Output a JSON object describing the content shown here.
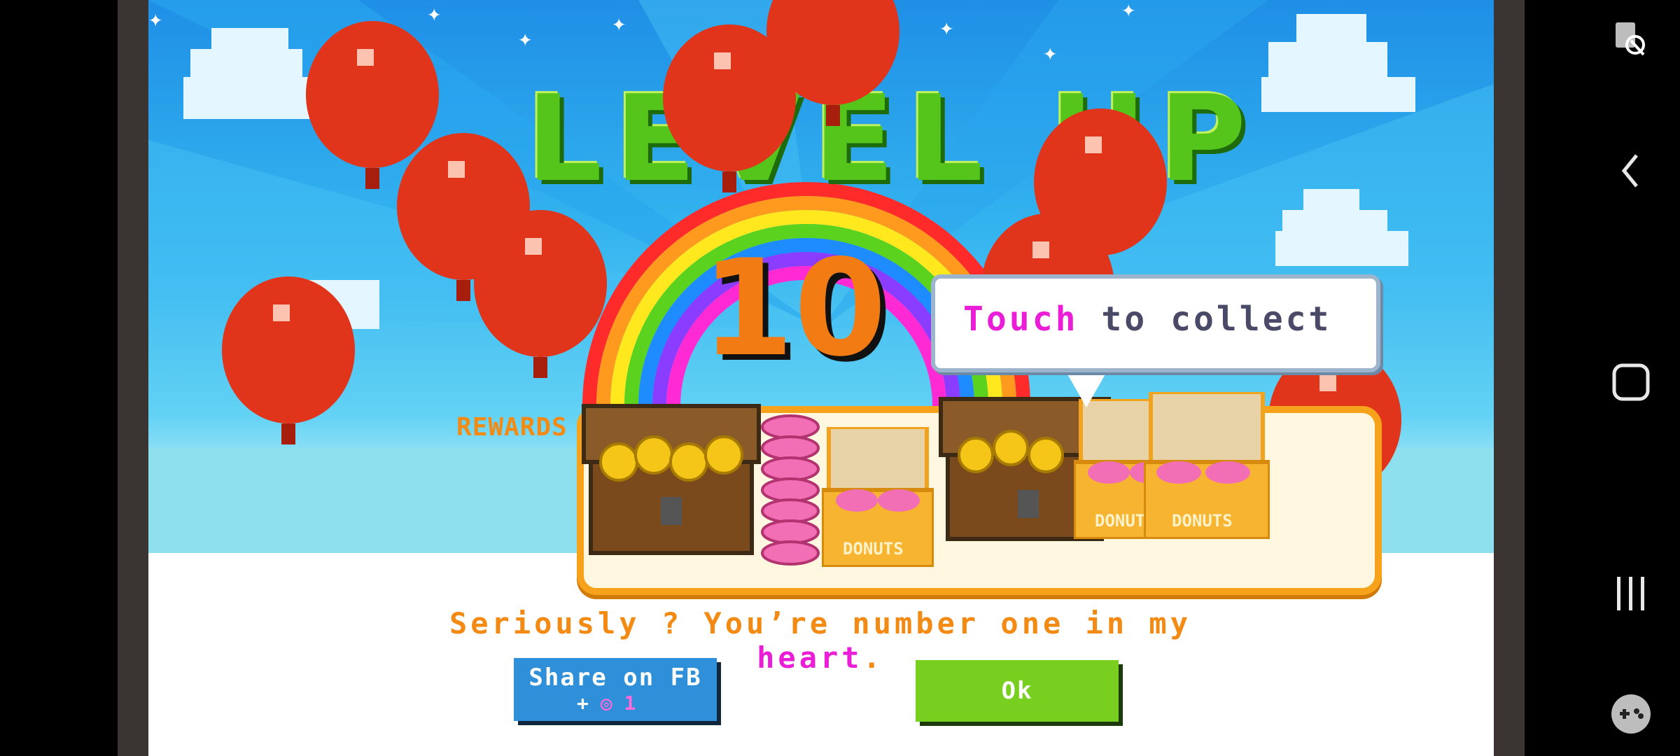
{
  "game": {
    "title": "LEVEL UP",
    "level_number": "10",
    "rewards_label": "REWARDS",
    "bubble": {
      "highlight": "Touch",
      "rest": " to collect"
    },
    "rewards": [
      {
        "name": "coin-chest",
        "label": ""
      },
      {
        "name": "donut-stack",
        "label": ""
      },
      {
        "name": "donut-box",
        "label": "DONUTS"
      },
      {
        "name": "coin-chest",
        "label": ""
      },
      {
        "name": "donut-box",
        "label": "DONUTS"
      },
      {
        "name": "donut-box",
        "label": "DONUTS"
      }
    ],
    "message": {
      "text": "Seriously ? You’re number one in my ",
      "highlight": "heart",
      "end": "."
    },
    "buttons": {
      "share_label": "Share on FB",
      "share_reward_prefix": "+",
      "share_reward_count": "1",
      "ok_label": "Ok"
    }
  },
  "system_nav": {
    "icons": [
      "screen-lock-icon",
      "back-icon",
      "home-icon",
      "recent-apps-icon",
      "game-launcher-icon"
    ]
  },
  "colors": {
    "accent_orange": "#f28a14",
    "highlight_pink": "#ea1ed6",
    "ok_green": "#78cf1f",
    "share_blue": "#2f8fd8",
    "title_green": "#55c51c"
  }
}
